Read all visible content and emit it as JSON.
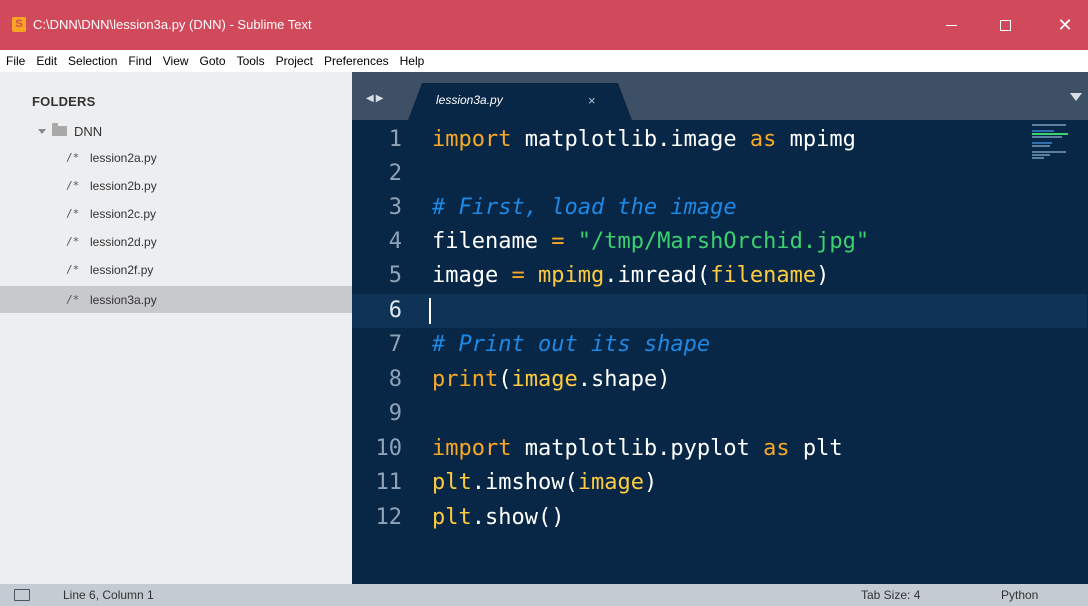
{
  "window": {
    "title": "C:\\DNN\\DNN\\lession3a.py (DNN) - Sublime Text",
    "app_icon_glyph": "S",
    "minimize_icon": "minimize-icon",
    "maximize_icon": "maximize-icon",
    "close_glyph": "✕"
  },
  "menu": [
    "File",
    "Edit",
    "Selection",
    "Find",
    "View",
    "Goto",
    "Tools",
    "Project",
    "Preferences",
    "Help"
  ],
  "sidebar": {
    "title": "FOLDERS",
    "folder": "DNN",
    "file_icon_glyph": "/*",
    "files": [
      "lession2a.py",
      "lession2b.py",
      "lession2c.py",
      "lession2d.py",
      "lession2f.py",
      "lession3a.py"
    ],
    "selected_index": 5
  },
  "tabs": {
    "nav_glyph": "◀▶",
    "active": {
      "label": "lession3a.py",
      "close_glyph": "×"
    }
  },
  "editor": {
    "active_line": 6,
    "line_numbers": [
      "1",
      "2",
      "3",
      "4",
      "5",
      "6",
      "7",
      "8",
      "9",
      "10",
      "11",
      "12"
    ],
    "code": {
      "l1_kw": "import",
      "l1_mod": " matplotlib.image ",
      "l1_as": "as",
      "l1_alias": " mpimg",
      "l3_comment": "# First, load the image",
      "l4_var": "filename ",
      "l4_op": "=",
      "l4_sp": " ",
      "l4_str": "\"/tmp/MarshOrchid.jpg\"",
      "l5_var": "image ",
      "l5_op": "=",
      "l5_sp": " ",
      "l5_fn": "mpimg",
      "l5_call": ".imread(",
      "l5_arg": "filename",
      "l5_close": ")",
      "l7_comment": "# Print out its shape",
      "l8_fn": "print",
      "l8_open": "(",
      "l8_arg": "image",
      "l8_rest": ".shape)",
      "l10_kw": "import",
      "l10_mod": " matplotlib.pyplot ",
      "l10_as": "as",
      "l10_alias": " plt",
      "l11_fn": "plt",
      "l11_call": ".imshow(",
      "l11_arg": "image",
      "l11_close": ")",
      "l12_fn": "plt",
      "l12_call": ".show()"
    }
  },
  "status": {
    "position": "Line 6, Column 1",
    "tab_size": "Tab Size: 4",
    "syntax": "Python"
  },
  "colors": {
    "titlebar": "#d14a5c",
    "editor_bg": "#082746",
    "keyword": "#f9a825",
    "comment": "#1e88e5",
    "string": "#3bd16f"
  }
}
